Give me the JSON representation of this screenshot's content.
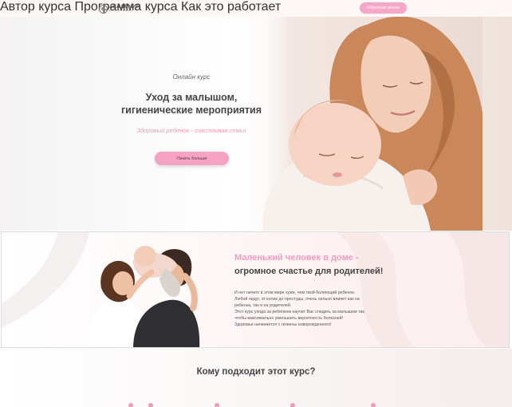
{
  "header": {
    "logo_title": "АКАДЕМИЯ",
    "logo_subtitle": "РАЗВИТИЯ РЕБЕНКА",
    "nav": [
      "Автор курса",
      "Программа курса",
      "Как это работает"
    ],
    "cta": "Обратный звонок"
  },
  "hero": {
    "kicker": "Онлайн курс",
    "title_line1": "Уход за малышом,",
    "title_line2": "гигиенические мероприятия",
    "subtitle": "Здоровый ребенок - счастливая семья",
    "button": "Узнать больше"
  },
  "about": {
    "title_accent": "Маленький человек в доме -",
    "title_rest": "огромное счастье для родителей!",
    "lines": [
      "И нет ничего в этом мире хуже, чем твой болеющий ребенок.",
      "Любой недуг, от колик до простуды, очень сильно влияет как на",
      "ребенка, так и на родителей.",
      "Этот курс ухода за ребенком научит Вас следить за малышом так,",
      "чтобы максимально уменьшить вероятность болезней!",
      "Здоровье начинается с гигиены новорожденного!"
    ]
  },
  "who": {
    "title": "Кому подходит этот курс?"
  },
  "colors": {
    "accent_pink": "#f6a6c6",
    "title_pink": "#f39ac0",
    "text_dark": "#444444"
  }
}
